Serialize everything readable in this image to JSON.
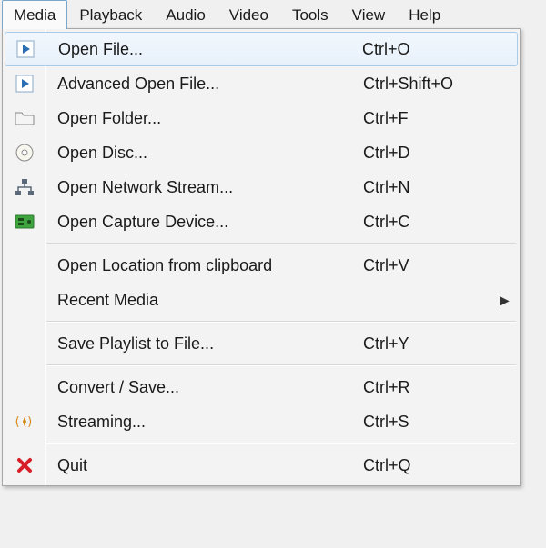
{
  "menubar": {
    "items": [
      {
        "label": "Media",
        "active": true
      },
      {
        "label": "Playback"
      },
      {
        "label": "Audio"
      },
      {
        "label": "Video"
      },
      {
        "label": "Tools"
      },
      {
        "label": "View"
      },
      {
        "label": "Help"
      }
    ]
  },
  "dropdown": {
    "items": [
      {
        "icon": "play-file-icon",
        "label": "Open File...",
        "accel": "Ctrl+O",
        "highlight": true
      },
      {
        "icon": "play-file-icon",
        "label": "Advanced Open File...",
        "accel": "Ctrl+Shift+O"
      },
      {
        "icon": "folder-icon",
        "label": "Open Folder...",
        "accel": "Ctrl+F"
      },
      {
        "icon": "disc-icon",
        "label": "Open Disc...",
        "accel": "Ctrl+D"
      },
      {
        "icon": "network-icon",
        "label": "Open Network Stream...",
        "accel": "Ctrl+N"
      },
      {
        "icon": "capture-card-icon",
        "label": "Open Capture Device...",
        "accel": "Ctrl+C"
      },
      {
        "separator": true
      },
      {
        "icon": "",
        "label": "Open Location from clipboard",
        "accel": "Ctrl+V"
      },
      {
        "icon": "",
        "label": "Recent Media",
        "submenu": true
      },
      {
        "separator": true
      },
      {
        "icon": "",
        "label": "Save Playlist to File...",
        "accel": "Ctrl+Y"
      },
      {
        "separator": true
      },
      {
        "icon": "",
        "label": "Convert / Save...",
        "accel": "Ctrl+R"
      },
      {
        "icon": "stream-icon",
        "label": "Streaming...",
        "accel": "Ctrl+S"
      },
      {
        "separator": true
      },
      {
        "icon": "quit-icon",
        "label": "Quit",
        "accel": "Ctrl+Q"
      }
    ]
  }
}
